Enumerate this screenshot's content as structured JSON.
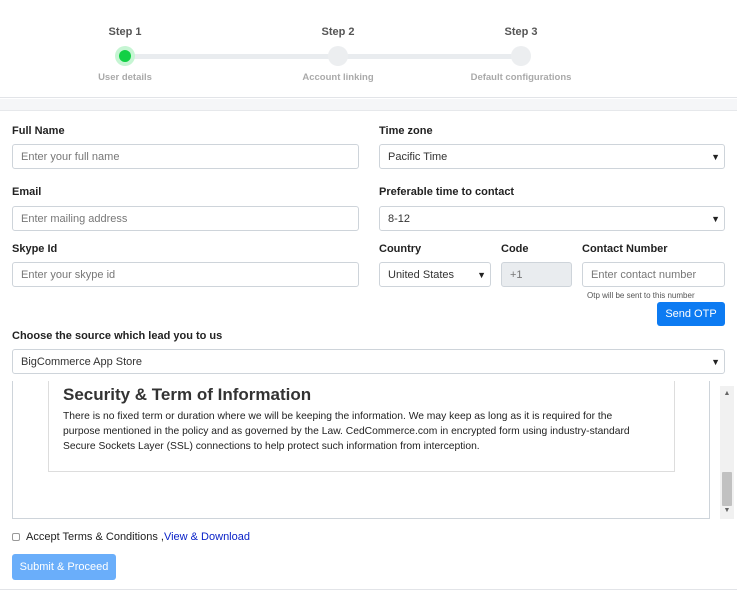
{
  "stepper": {
    "steps": [
      {
        "title": "Step 1",
        "subtitle": "User details",
        "active": true
      },
      {
        "title": "Step 2",
        "subtitle": "Account linking",
        "active": false
      },
      {
        "title": "Step 3",
        "subtitle": "Default configurations",
        "active": false
      }
    ],
    "colors": {
      "active": "#12d045",
      "inactive": "#eceef0"
    }
  },
  "form": {
    "full_name": {
      "label": "Full Name",
      "placeholder": "Enter your full name"
    },
    "time_zone": {
      "label": "Time zone",
      "value": "Pacific Time"
    },
    "email": {
      "label": "Email",
      "placeholder": "Enter mailing address"
    },
    "contact_time": {
      "label": "Preferable time to contact",
      "value": "8-12"
    },
    "skype": {
      "label": "Skype Id",
      "placeholder": "Enter your skype id"
    },
    "country": {
      "label": "Country",
      "value": "United States"
    },
    "code": {
      "label": "Code",
      "value": "+1"
    },
    "contact_number": {
      "label": "Contact Number",
      "placeholder": "Enter contact number",
      "note": "Otp will be sent to this number"
    },
    "send_otp": "Send OTP",
    "source": {
      "label": "Choose the source which lead you to us",
      "value": "BigCommerce App Store"
    }
  },
  "terms": {
    "title": "Security & Term of Information",
    "lines": [
      "There is no fixed term or duration where we will be keeping the information. We may keep as long as it is required for the",
      "purpose mentioned in the policy and as governed by the Law. CedCommerce.com in encrypted form using industry-standard",
      "Secure Sockets Layer (SSL) connections to help protect such information from interception."
    ]
  },
  "accept": {
    "label": "Accept Terms & Conditions ,",
    "link": "View & Download"
  },
  "submit": "Submit & Proceed",
  "colors": {
    "primary": "#0d7bf2",
    "primary_disabled": "#6aaefa",
    "link": "#0a22c8"
  }
}
